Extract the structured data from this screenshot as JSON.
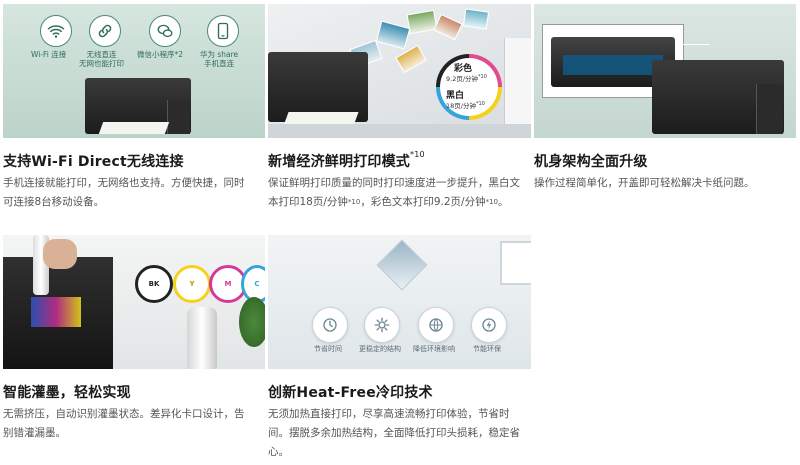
{
  "cards": [
    {
      "title": "支持Wi-Fi Direct无线连接",
      "desc": "手机连接就能打印，无网络也支持。方便快捷，同时可连接8台移动设备。",
      "icons": [
        {
          "label": "Wi-Fi 连接",
          "icon": "wifi-icon"
        },
        {
          "label": "无线直连\n无网也能打印",
          "icon": "link-icon"
        },
        {
          "label": "微信小程序*2",
          "icon": "wechat-icon"
        },
        {
          "label": "华为 share\n手机直连",
          "icon": "phone-icon"
        }
      ]
    },
    {
      "title": "新增经济鲜明打印模式",
      "title_sup": "*10",
      "desc_a": "保证鲜明打印质量的同时打印速度进一步提升，黑白文本打印18页/分钟",
      "desc_sup1": "*10",
      "desc_b": "，彩色文本打印9.2页/分钟",
      "desc_sup2": "*10",
      "desc_c": "。",
      "badge_color_label": "彩色",
      "badge_color_speed": "9.2页/分钟",
      "badge_color_sup": "*10",
      "badge_black_label": "黑白",
      "badge_black_speed": "18页/分钟",
      "badge_black_sup": "*10"
    },
    {
      "title": "机身架构全面升级",
      "desc": "操作过程简单化，开盖即可轻松解决卡纸问题。"
    },
    {
      "title": "智能灌墨，轻松实现",
      "desc": "无需挤压，自动识别灌墨状态。差异化卡口设计，告别错灌漏墨。",
      "ink_labels": [
        "BK",
        "Y",
        "M",
        "C"
      ]
    },
    {
      "title": "创新Heat-Free冷印技术",
      "desc": "无须加热直接打印，尽享高速流畅打印体验，节省时间。摆脱多余加热结构，全面降低打印头损耗，稳定省心。",
      "feature_labels": [
        "节省时间",
        "更稳定的结构",
        "降低环境影响",
        "节能环保"
      ]
    }
  ],
  "colors": {
    "card1_bg": "#c9dcd4",
    "accent_green": "#2f6b5e",
    "ink_bk": "#222222",
    "ink_y": "#f2d21c",
    "ink_m": "#d6379a",
    "ink_c": "#35a4dc"
  }
}
